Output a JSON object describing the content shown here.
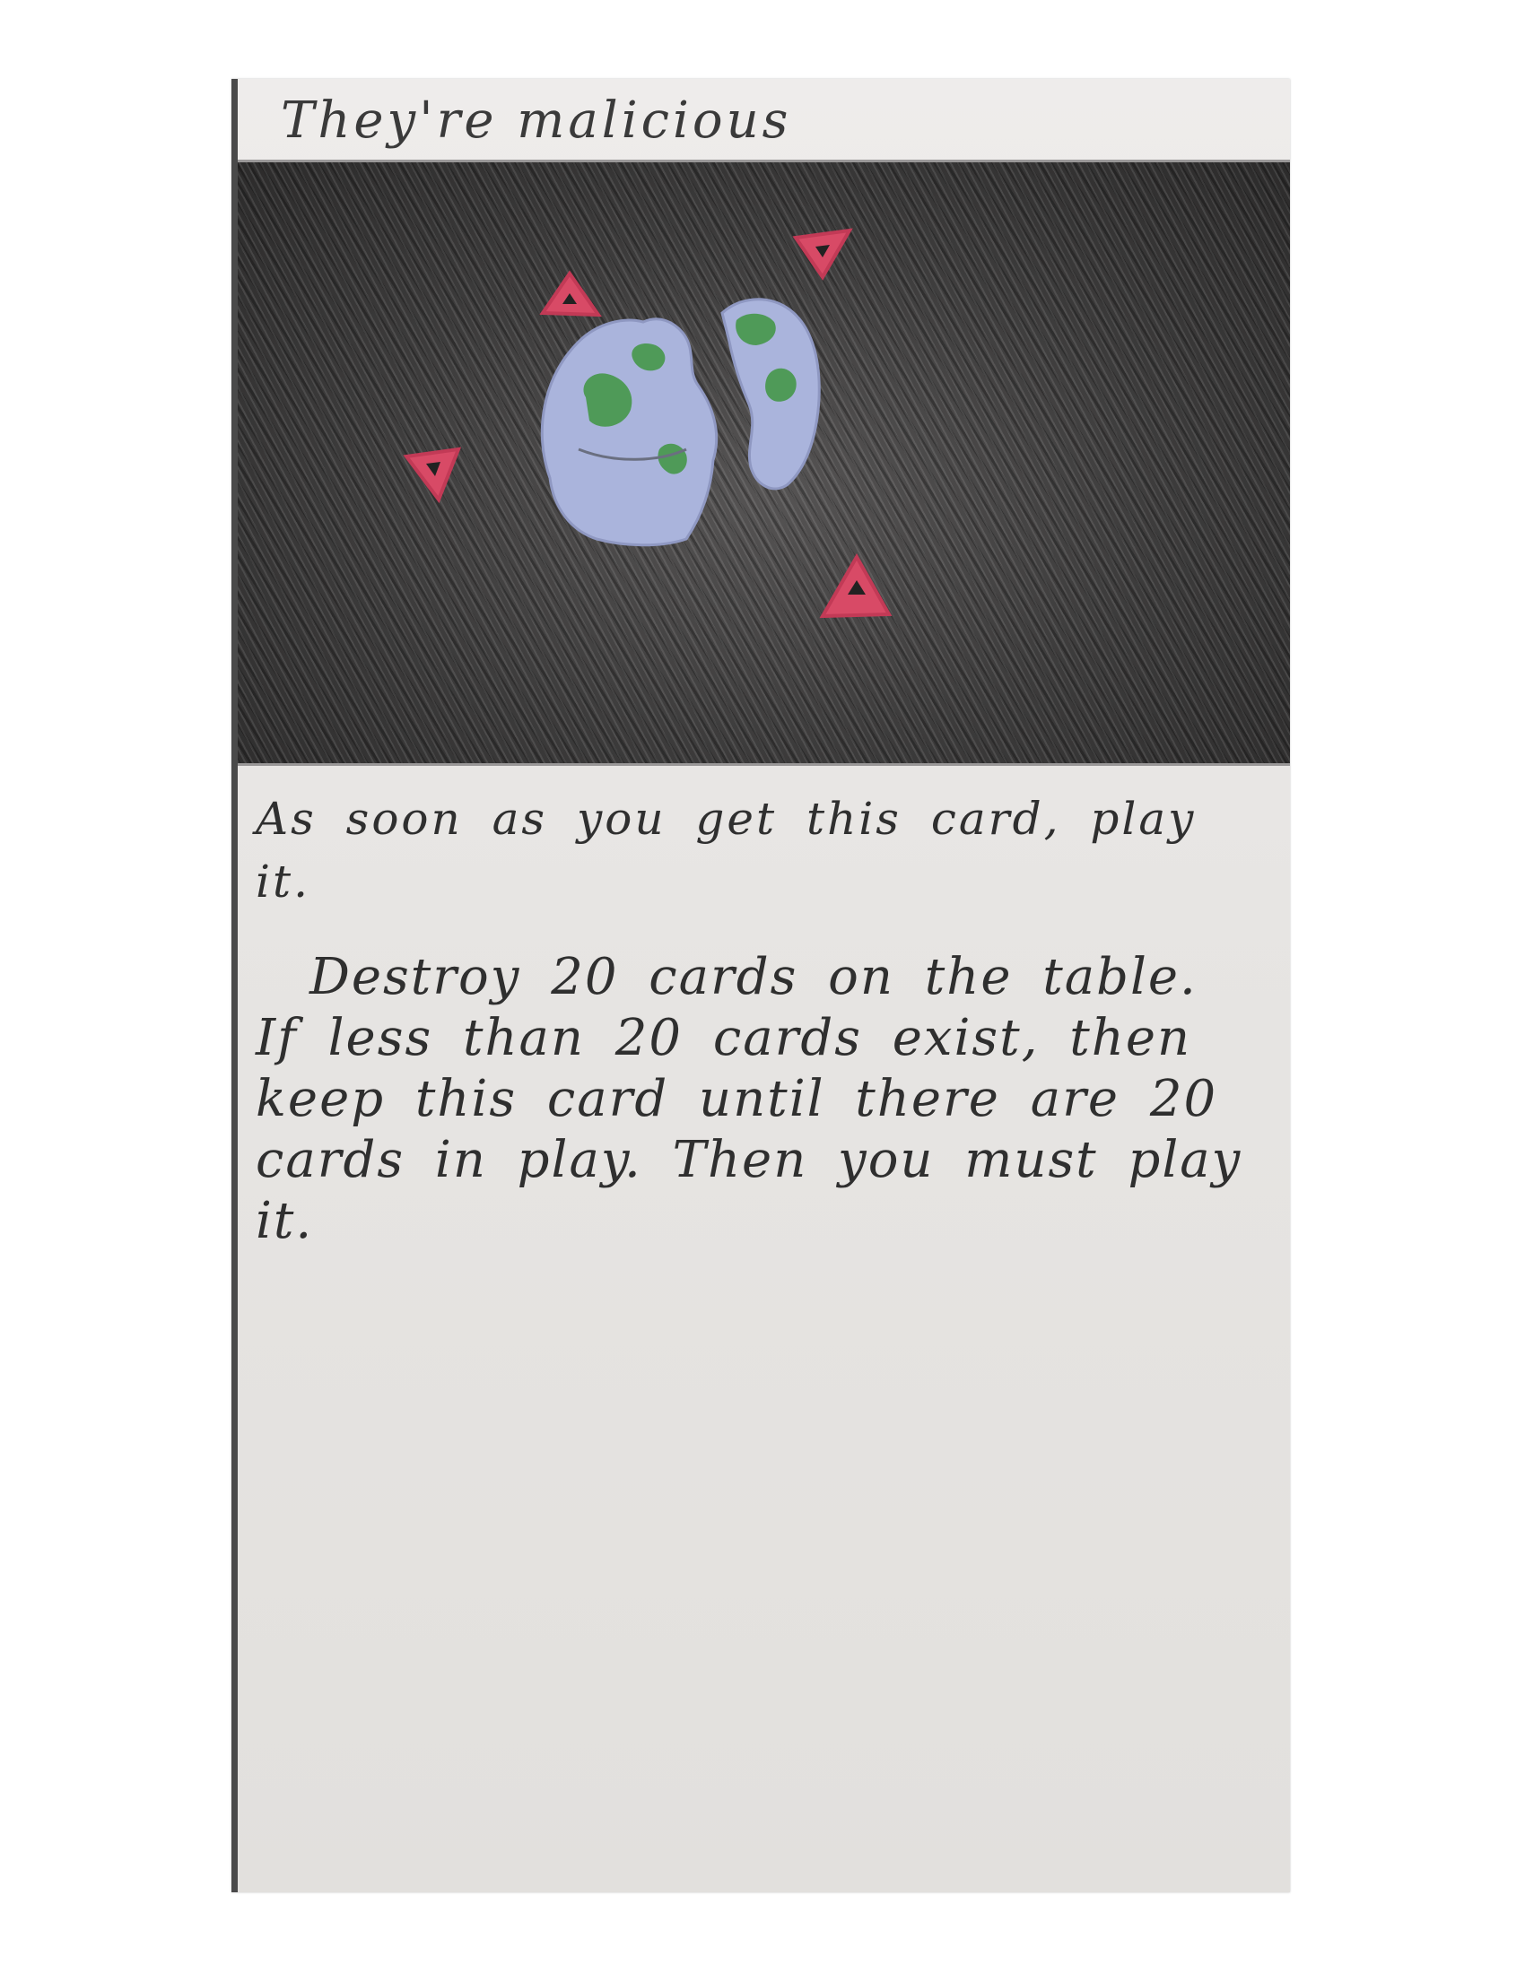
{
  "card": {
    "title": "They're malicious",
    "rules": [
      "As soon as you get this card, play it.",
      "Destroy 20 cards on the table. If less than 20 cards exist, then keep this card until there are 20 cards in play. Then you must play it."
    ]
  },
  "colors": {
    "paper": "#e8e6e4",
    "pencil": "#2f2f2f",
    "shading": "#3e3d3d",
    "earth_blue": "#aab4dc",
    "earth_green": "#4f9a58",
    "marker_red": "#d84a66"
  }
}
